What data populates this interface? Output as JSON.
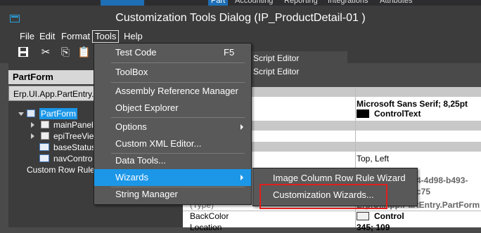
{
  "background_app": {
    "tabs": [
      "Part",
      "Accounting",
      "Reporting",
      "Integrations",
      "Attributes"
    ]
  },
  "window": {
    "title": "Customization Tools Dialog  (IP_ProductDetail-01 )"
  },
  "menubar": {
    "items": [
      "File",
      "Edit",
      "Format",
      "Tools",
      "Help"
    ]
  },
  "tools_menu": {
    "items": [
      {
        "label": "Test Code",
        "shortcut": "F5"
      },
      {
        "label": "ToolBox"
      },
      {
        "label": "Assembly Reference Manager"
      },
      {
        "label": "Object Explorer"
      },
      {
        "label": "Options"
      },
      {
        "label": "Custom XML Editor..."
      },
      {
        "label": "Data Tools..."
      },
      {
        "label": "Wizards"
      },
      {
        "label": "String Manager"
      }
    ]
  },
  "wizards_submenu": {
    "items": [
      "Image Column Row Rule Wizard",
      "Customization Wizards..."
    ]
  },
  "left_panel": {
    "title": "PartForm",
    "path": "Erp.UI.App.PartEntry.",
    "tree": [
      "PartForm",
      "mainPanel",
      "epiTreeVie",
      "baseStatus",
      "navContro",
      "Custom Row Rules"
    ]
  },
  "editor": {
    "tab_label": "Script Editor"
  },
  "properties": {
    "font_value": "Microsoft Sans Serif; 8,25pt",
    "forecolor_value": "ControlText",
    "anchor_value": "Top, Left",
    "guid_partial": "4-4d98-b493-c75",
    "type_label": "(Type)",
    "type_value": "Erp.UI.App.PartEntry.PartForm",
    "backcolor_label": "BackColor",
    "backcolor_value": "Control",
    "location_label": "Location",
    "location_value": "345; 109"
  },
  "colors": {
    "accent": "#1c97e8",
    "highlight_box": "#e01e1e",
    "menu_bg": "#595959",
    "chrome_bg": "#3c3c3c"
  }
}
